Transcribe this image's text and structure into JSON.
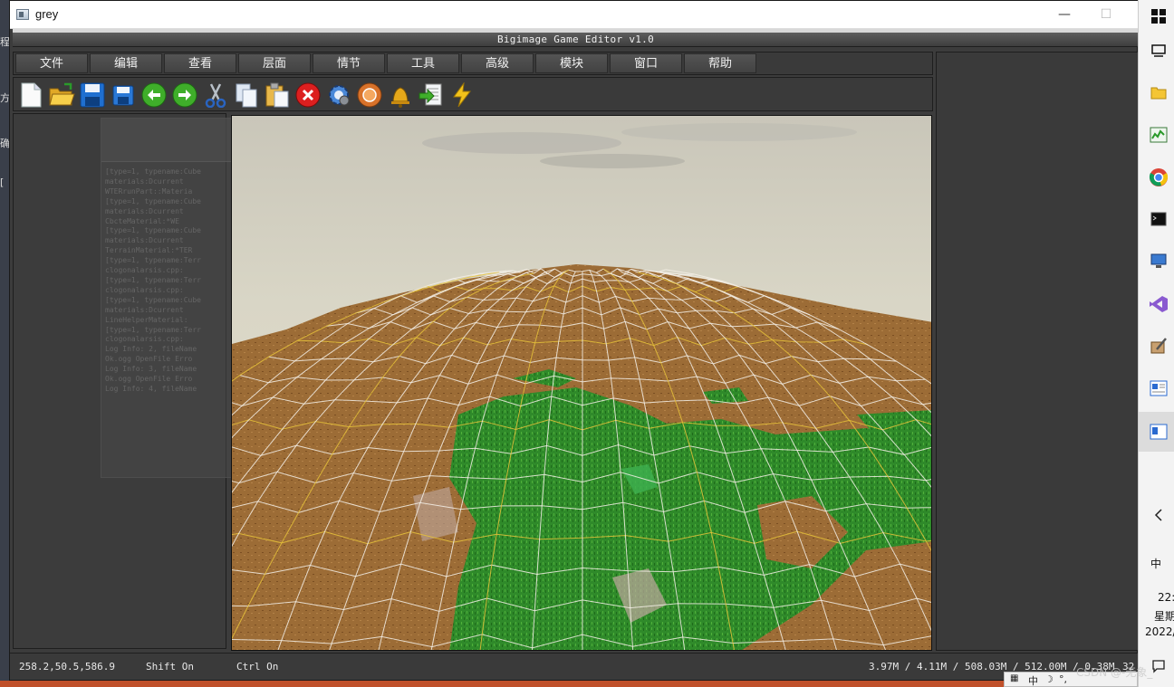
{
  "window": {
    "title": "grey",
    "minimize_glyph": "—",
    "maximize_glyph": "☐",
    "inner_caption": "Bigimage Game Editor v1.0"
  },
  "menu": [
    {
      "label": "文件"
    },
    {
      "label": "编辑"
    },
    {
      "label": "查看"
    },
    {
      "label": "层面"
    },
    {
      "label": "情节"
    },
    {
      "label": "工具"
    },
    {
      "label": "高级"
    },
    {
      "label": "模块"
    },
    {
      "label": "窗口"
    },
    {
      "label": "帮助"
    }
  ],
  "toolbar": [
    {
      "icon": "new-file-icon"
    },
    {
      "icon": "open-folder-icon"
    },
    {
      "icon": "save-icon"
    },
    {
      "icon": "save-as-icon"
    },
    {
      "icon": "back-arrow-icon"
    },
    {
      "icon": "forward-arrow-icon"
    },
    {
      "icon": "cut-icon"
    },
    {
      "icon": "copy-icon"
    },
    {
      "icon": "paste-icon"
    },
    {
      "icon": "delete-icon"
    },
    {
      "icon": "settings-gear-icon"
    },
    {
      "icon": "orange-disc-icon"
    },
    {
      "icon": "bell-icon"
    },
    {
      "icon": "export-icon"
    },
    {
      "icon": "lightning-icon"
    }
  ],
  "ghost_log": [
    "[type=1, typename:Cube",
    "materials:Dcurrent",
    "WTERrunPart::Materia",
    "[type=1, typename:Cube",
    "materials:Dcurrent",
    "CbcteMaterial:*WE",
    "[type=1, typename:Cube",
    "materials:Dcurrent",
    "TerrainMaterial:*TER",
    "[type=1, typename:Terr",
    "clogonalarsis.cpp:",
    "[type=1, typename:Terr",
    "clogonalarsis.cpp:",
    "[type=1, typename:Cube",
    "materials:Dcurrent",
    "LineHelperMaterial:",
    "[type=1, typename:Terr",
    "clogonalarsis.cpp:",
    "Log Info: 2, fileName",
    "Ok.ogg OpenFile Erro",
    "Log Info: 3, fileName",
    "Ok.ogg OpenFile Erro",
    "Log Info: 4, fileName"
  ],
  "status": {
    "coords": "258.2,50.5,586.9",
    "shift": "Shift On",
    "ctrl": "Ctrl On",
    "memory": "3.97M / 4.11M / 508.03M / 512.00M / 0.38M",
    "fps": "32"
  },
  "taskbar": {
    "ime": "中",
    "time": "22:",
    "weekday": "星期",
    "date": "2022/",
    "tray_ime": "中",
    "watermark": "CSDN @-无象_"
  },
  "left_sliver": [
    "程",
    "方",
    "确",
    "["
  ],
  "colors": {
    "panel": "#3c3c3c",
    "sky_top": "#d8d6c8",
    "terrain_brown": "#9a6a34",
    "grass_green": "#2f8a2a",
    "grid_white": "#f4f0e8",
    "grid_yellow": "#e6c23a"
  }
}
